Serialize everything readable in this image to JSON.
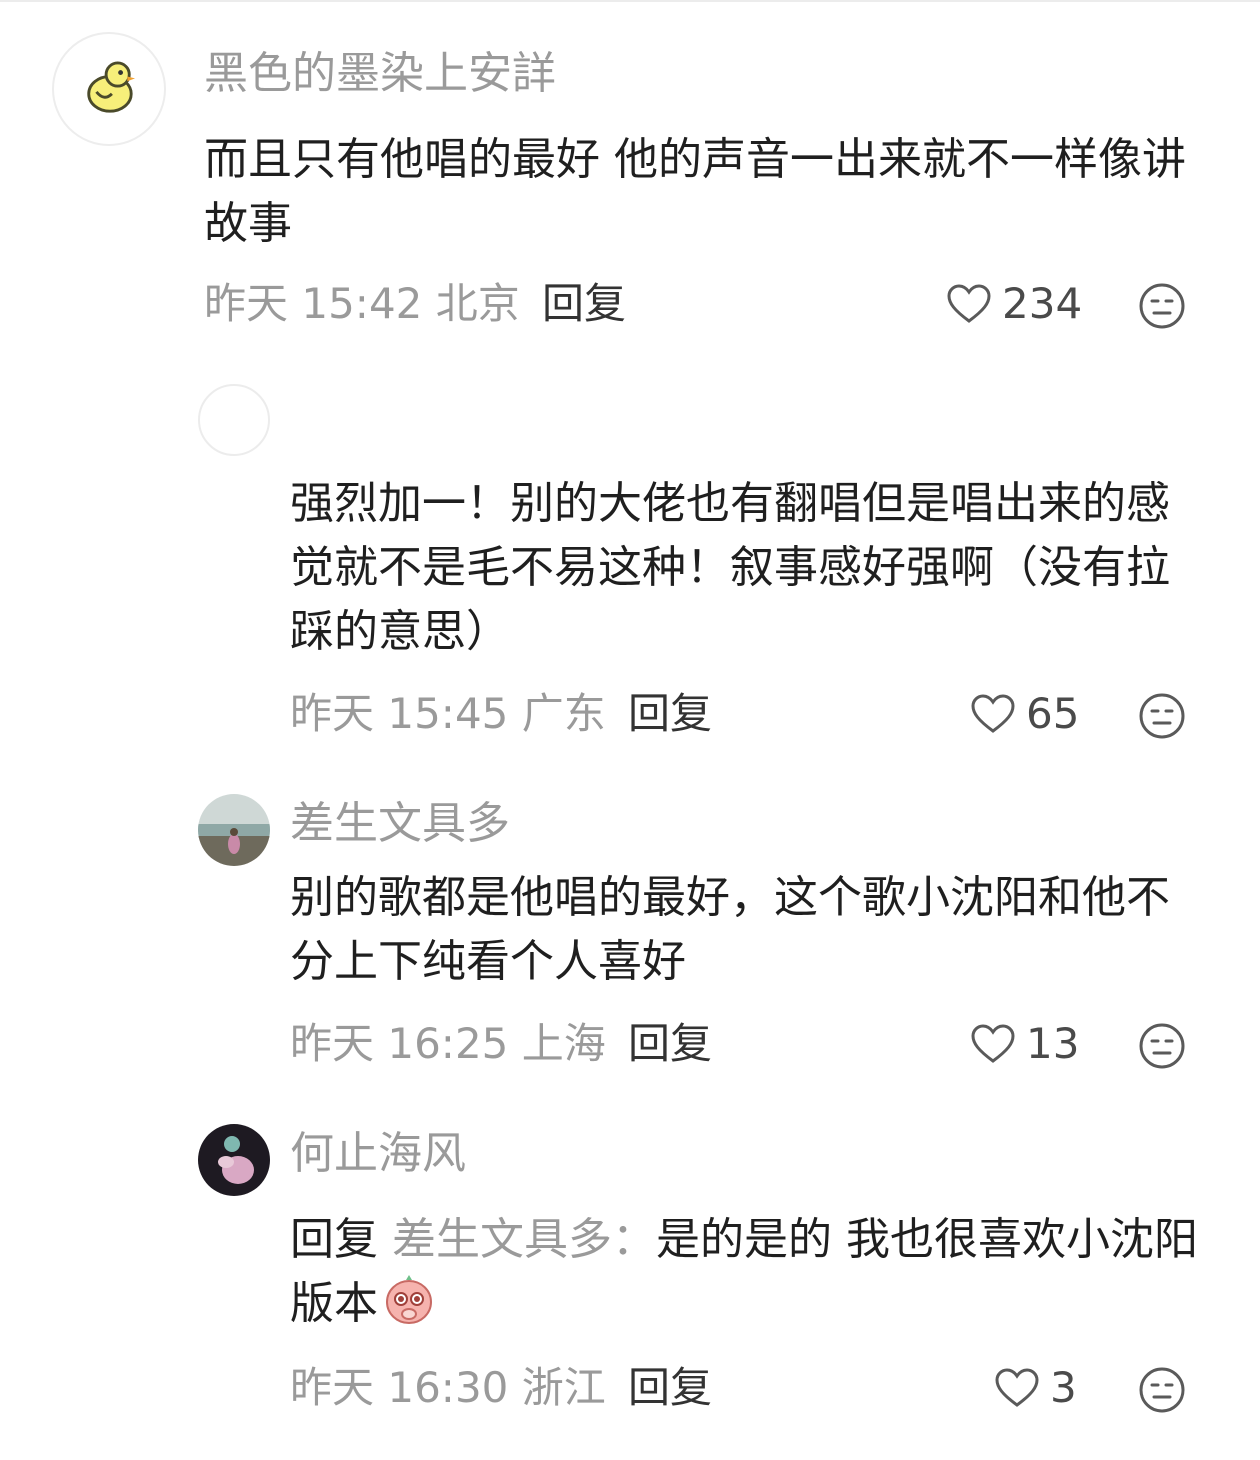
{
  "comments": [
    {
      "username": "黑色的墨染上安詳",
      "text": "而且只有他唱的最好 他的声音一出来就不一样像讲故事",
      "time": "昨天 15:42",
      "location": "北京",
      "reply_label": "回复",
      "likes": "234",
      "avatar_icon": "chick-avatar"
    },
    {
      "username": "",
      "text": "强烈加一！别的大佬也有翻唱但是唱出来的感觉就不是毛不易这种！叙事感好强啊（没有拉踩的意思）",
      "time": "昨天 15:45",
      "location": "广东",
      "reply_label": "回复",
      "likes": "65",
      "avatar_icon": "blank-avatar"
    },
    {
      "username": "差生文具多",
      "text": "别的歌都是他唱的最好，这个歌小沈阳和他不分上下纯看个人喜好",
      "time": "昨天 16:25",
      "location": "上海",
      "reply_label": "回复",
      "likes": "13",
      "avatar_icon": "seaside-photo-avatar"
    },
    {
      "username": "何止海风",
      "reply_prefix": "回复",
      "reply_target": "差生文具多：",
      "text": "是的是的 我也很喜欢小沈阳版本",
      "time": "昨天 16:30",
      "location": "浙江",
      "reply_label": "回复",
      "likes": "3",
      "avatar_icon": "dark-photo-avatar",
      "inline_emoji": "pleading-face-emoji"
    }
  ],
  "colors": {
    "secondary_text": "#9a9a9a",
    "primary_text": "#1f1f1f",
    "icon_stroke": "#5a5a5a"
  }
}
